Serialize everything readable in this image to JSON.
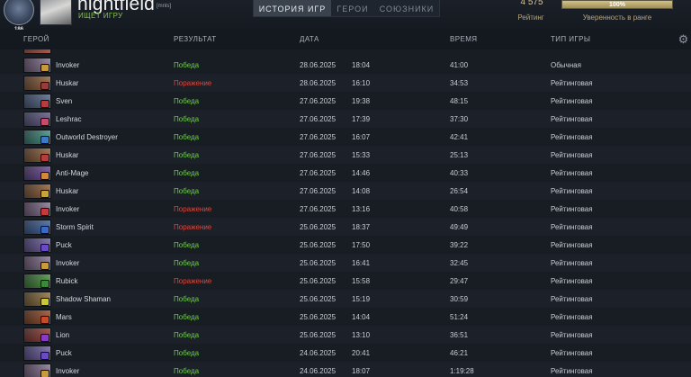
{
  "player": {
    "name": "nightfield",
    "tag": "[mnls]",
    "status": "ИЩЕТ ИГРУ",
    "rank_number": "186"
  },
  "tabs": [
    {
      "label": "ИСТОРИЯ ИГР",
      "active": true
    },
    {
      "label": "ГЕРОИ",
      "active": false
    },
    {
      "label": "СОЮЗНИКИ",
      "active": false
    }
  ],
  "rating": {
    "value": "4 575",
    "label": "Рейтинг"
  },
  "confidence": {
    "value": "100%",
    "fraction": 1.0,
    "label": "Уверенность в ранге"
  },
  "columns": {
    "hero": "ГЕРОЙ",
    "result": "РЕЗУЛЬТАТ",
    "date": "ДАТА",
    "time": "ВРЕМЯ",
    "type": "ТИП ИГРЫ"
  },
  "icons": {
    "settings": "gear-icon"
  },
  "colors": {
    "win": "#6fcf4a",
    "loss": "#e0463a",
    "accent_gold": "#d9c79a"
  },
  "matches": [
    {
      "hero": "Invoker",
      "result": "Победа",
      "outcome": "win",
      "date": "28.06.2025",
      "clock": "18:04",
      "duration": "41:00",
      "type": "Обычная",
      "portrait": [
        "#3a2a3c",
        "#b7a6c9"
      ],
      "badge": "#c89a3a"
    },
    {
      "hero": "Huskar",
      "result": "Поражение",
      "outcome": "loss",
      "date": "28.06.2025",
      "clock": "16:10",
      "duration": "34:53",
      "type": "Рейтинговая",
      "portrait": [
        "#3c2a22",
        "#c78a52"
      ],
      "badge": "#9a3a3a"
    },
    {
      "hero": "Sven",
      "result": "Победа",
      "outcome": "win",
      "date": "27.06.2025",
      "clock": "19:38",
      "duration": "48:15",
      "type": "Рейтинговая",
      "portrait": [
        "#27324a",
        "#7a8fb5"
      ],
      "badge": "#b83c3c"
    },
    {
      "hero": "Leshrac",
      "result": "Победа",
      "outcome": "win",
      "date": "27.06.2025",
      "clock": "17:39",
      "duration": "37:30",
      "type": "Рейтинговая",
      "portrait": [
        "#2d3248",
        "#8d7ab3"
      ],
      "badge": "#c84b6a"
    },
    {
      "hero": "Outworld Destroyer",
      "result": "Победа",
      "outcome": "win",
      "date": "27.06.2025",
      "clock": "16:07",
      "duration": "42:41",
      "type": "Рейтинговая",
      "portrait": [
        "#1f3a3a",
        "#5fc7b0"
      ],
      "badge": "#3a7ac8"
    },
    {
      "hero": "Huskar",
      "result": "Победа",
      "outcome": "win",
      "date": "27.06.2025",
      "clock": "15:33",
      "duration": "25:13",
      "type": "Рейтинговая",
      "portrait": [
        "#3c2a22",
        "#c78a52"
      ],
      "badge": "#b83c3c"
    },
    {
      "hero": "Anti-Mage",
      "result": "Победа",
      "outcome": "win",
      "date": "27.06.2025",
      "clock": "14:46",
      "duration": "40:33",
      "type": "Рейтинговая",
      "portrait": [
        "#2e2540",
        "#9a6ad0"
      ],
      "badge": "#d08a3a"
    },
    {
      "hero": "Huskar",
      "result": "Победа",
      "outcome": "win",
      "date": "27.06.2025",
      "clock": "14:08",
      "duration": "26:54",
      "type": "Рейтинговая",
      "portrait": [
        "#3c2a22",
        "#c78a52"
      ],
      "badge": "#c8a33a"
    },
    {
      "hero": "Invoker",
      "result": "Поражение",
      "outcome": "loss",
      "date": "27.06.2025",
      "clock": "13:16",
      "duration": "40:58",
      "type": "Рейтинговая",
      "portrait": [
        "#3a2a3c",
        "#b7a6c9"
      ],
      "badge": "#c83a3a"
    },
    {
      "hero": "Storm Spirit",
      "result": "Поражение",
      "outcome": "loss",
      "date": "25.06.2025",
      "clock": "18:37",
      "duration": "49:49",
      "type": "Рейтинговая",
      "portrait": [
        "#22304a",
        "#5a8ad0"
      ],
      "badge": "#3a6ac8"
    },
    {
      "hero": "Puck",
      "result": "Победа",
      "outcome": "win",
      "date": "25.06.2025",
      "clock": "17:50",
      "duration": "39:22",
      "type": "Рейтинговая",
      "portrait": [
        "#2a2848",
        "#a08ad8"
      ],
      "badge": "#6a4ac8"
    },
    {
      "hero": "Invoker",
      "result": "Победа",
      "outcome": "win",
      "date": "25.06.2025",
      "clock": "16:41",
      "duration": "32:45",
      "type": "Рейтинговая",
      "portrait": [
        "#3a2a3c",
        "#b7a6c9"
      ],
      "badge": "#c89a3a"
    },
    {
      "hero": "Rubick",
      "result": "Поражение",
      "outcome": "loss",
      "date": "25.06.2025",
      "clock": "15:58",
      "duration": "29:47",
      "type": "Рейтинговая",
      "portrait": [
        "#1f3a22",
        "#6ac85a"
      ],
      "badge": "#3a8a3a"
    },
    {
      "hero": "Shadow Shaman",
      "result": "Победа",
      "outcome": "win",
      "date": "25.06.2025",
      "clock": "15:19",
      "duration": "30:59",
      "type": "Рейтинговая",
      "portrait": [
        "#3a3020",
        "#c8a05a"
      ],
      "badge": "#c8c83a"
    },
    {
      "hero": "Mars",
      "result": "Победа",
      "outcome": "win",
      "date": "25.06.2025",
      "clock": "14:04",
      "duration": "51:24",
      "type": "Рейтинговая",
      "portrait": [
        "#3c2418",
        "#d07040"
      ],
      "badge": "#c84a2a"
    },
    {
      "hero": "Lion",
      "result": "Победа",
      "outcome": "win",
      "date": "25.06.2025",
      "clock": "13:10",
      "duration": "36:51",
      "type": "Рейтинговая",
      "portrait": [
        "#3a2020",
        "#c85a4a"
      ],
      "badge": "#8a3ac8"
    },
    {
      "hero": "Puck",
      "result": "Победа",
      "outcome": "win",
      "date": "24.06.2025",
      "clock": "20:41",
      "duration": "46:21",
      "type": "Рейтинговая",
      "portrait": [
        "#2a2848",
        "#a08ad8"
      ],
      "badge": "#6a4ac8"
    },
    {
      "hero": "Invoker",
      "result": "Победа",
      "outcome": "win",
      "date": "24.06.2025",
      "clock": "18:07",
      "duration": "1:19:28",
      "type": "Рейтинговая",
      "portrait": [
        "#3a2a3c",
        "#b7a6c9"
      ],
      "badge": "#c89a3a"
    }
  ]
}
